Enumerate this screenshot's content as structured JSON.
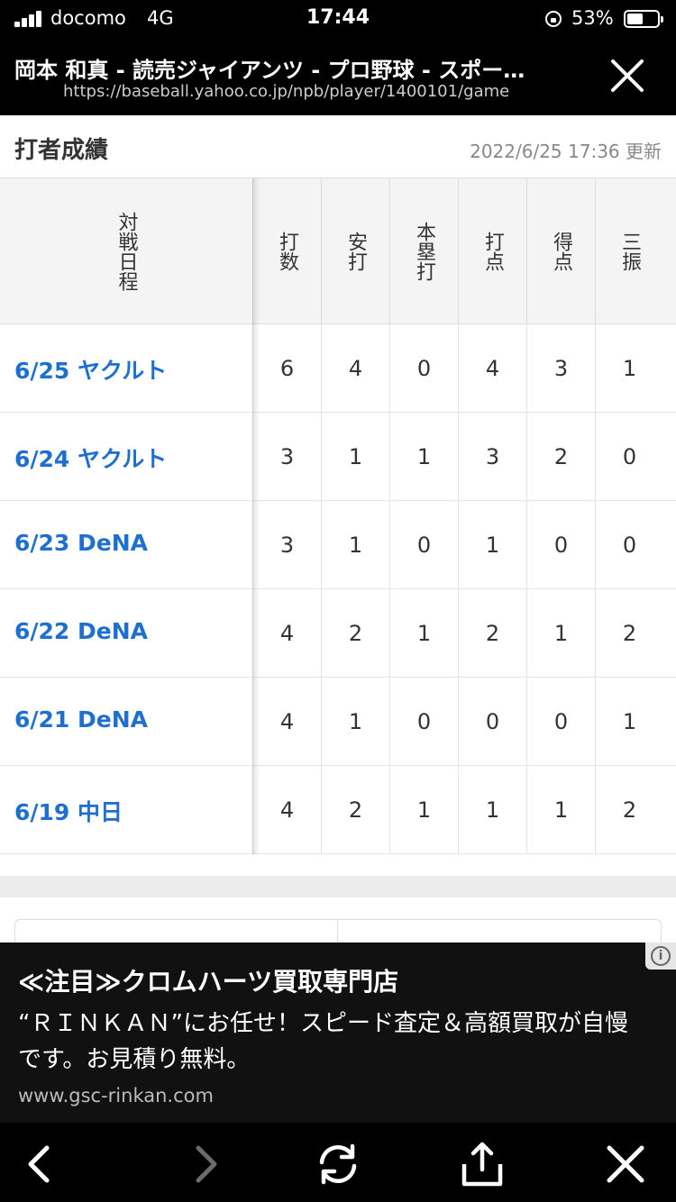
{
  "status_bar": {
    "carrier": "docomo",
    "network": "4G",
    "time": "17:44",
    "battery": "53%",
    "battery_level": 0.53
  },
  "browser": {
    "page_title": "岡本 和真 - 読売ジャイアンツ - プロ野球 - スポー…",
    "url": "https://baseball.yahoo.co.jp/npb/player/1400101/game"
  },
  "section": {
    "title": "打者成績",
    "updated": "2022/6/25 17:36 更新"
  },
  "table": {
    "date_header": "対戦日程",
    "columns": [
      "打数",
      "安打",
      "本塁打",
      "打点",
      "得点",
      "三振"
    ],
    "rows": [
      {
        "date": "6/25 ヤクルト",
        "values": [
          "6",
          "4",
          "0",
          "4",
          "3",
          "1"
        ]
      },
      {
        "date": "6/24 ヤクルト",
        "values": [
          "3",
          "1",
          "1",
          "3",
          "2",
          "0"
        ]
      },
      {
        "date": "6/23 DeNA",
        "values": [
          "3",
          "1",
          "0",
          "1",
          "0",
          "0"
        ]
      },
      {
        "date": "6/22 DeNA",
        "values": [
          "4",
          "2",
          "1",
          "2",
          "1",
          "2"
        ]
      },
      {
        "date": "6/21 DeNA",
        "values": [
          "4",
          "1",
          "0",
          "0",
          "0",
          "1"
        ]
      },
      {
        "date": "6/19 中日",
        "values": [
          "4",
          "2",
          "1",
          "1",
          "1",
          "2"
        ]
      }
    ]
  },
  "ad": {
    "headline": "≪注目≫クロムハーツ買取専門店",
    "body": "“ＲＩＮＫＡＮ”にお任せ！スピード査定＆高額買取が自慢です。お見積り無料。",
    "url": "www.gsc-rinkan.com",
    "info_icon": "i"
  },
  "toolbar": {
    "icons": [
      "back-icon",
      "forward-icon",
      "reload-icon",
      "share-icon",
      "close-icon"
    ],
    "colors": {
      "active": "#ffffff",
      "disabled": "#6b6b6b"
    }
  },
  "colors": {
    "link": "#1f6fd1",
    "header_bg": "#f4f4f4"
  }
}
